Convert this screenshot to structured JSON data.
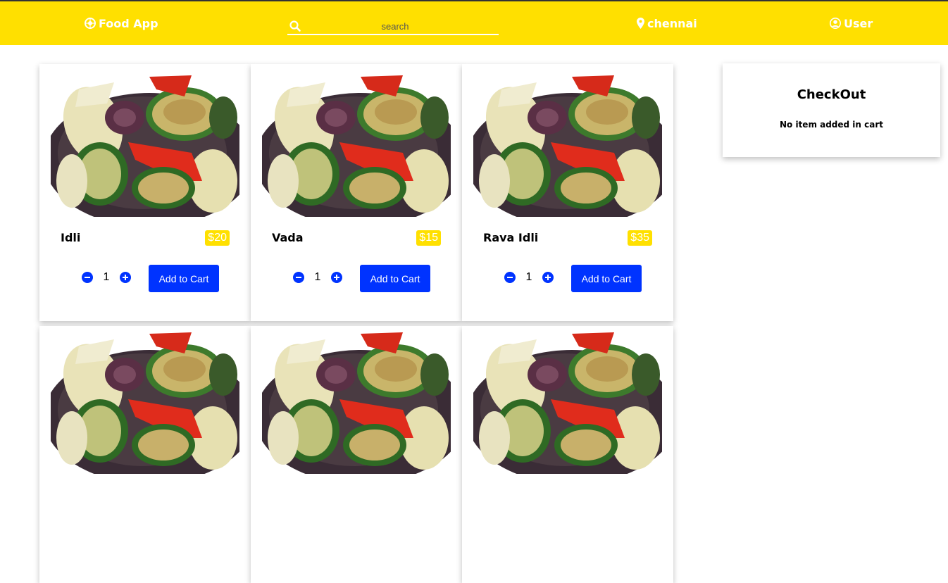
{
  "navbar": {
    "brand": "Food App",
    "search_placeholder": "search",
    "location": "chennai",
    "user": "User"
  },
  "colors": {
    "accent": "#ffe000",
    "button": "#0033ff"
  },
  "products": [
    {
      "name": "Idli",
      "price": "$20",
      "qty": "1",
      "button": "Add to Cart",
      "image": "grilled-vegetables"
    },
    {
      "name": "Vada",
      "price": "$15",
      "qty": "1",
      "button": "Add to Cart",
      "image": "grilled-vegetables"
    },
    {
      "name": "Rava Idli",
      "price": "$35",
      "qty": "1",
      "button": "Add to Cart",
      "image": "grilled-vegetables"
    },
    {
      "image": "grilled-vegetables"
    },
    {
      "image": "grilled-vegetables"
    },
    {
      "image": "grilled-vegetables"
    }
  ],
  "checkout": {
    "title": "CheckOut",
    "message": "No item added in cart"
  }
}
